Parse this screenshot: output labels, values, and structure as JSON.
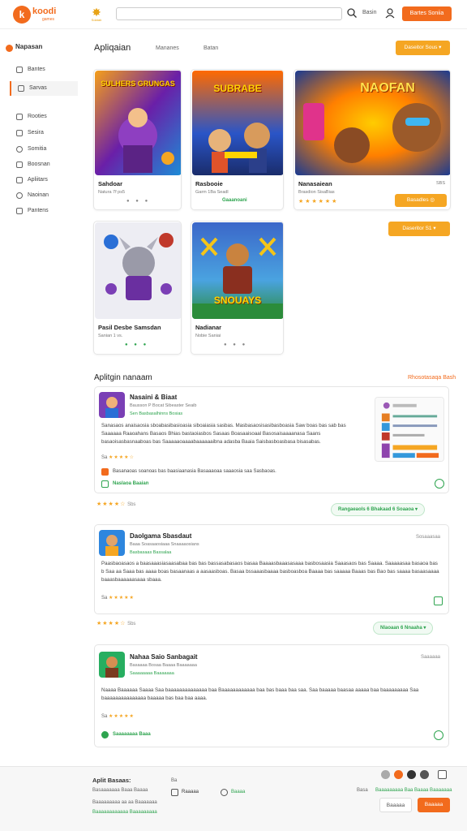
{
  "header": {
    "logo_letter": "k",
    "logo_text": "koodi",
    "logo_sub": "games",
    "badge_label": "Sdatab",
    "search_placeholder": "",
    "link": "Basin",
    "cta": "Bartes Soniia"
  },
  "sidebar": {
    "title": "Napasan",
    "items": [
      "Bantes",
      "Sarvas",
      "Rooties",
      "Sesira",
      "Somitia",
      "Boosnan",
      "Apliitars",
      "Naoinan",
      "Pantens"
    ]
  },
  "main": {
    "title": "Apliqaian",
    "tabs": [
      "Mananes",
      "Batan"
    ],
    "sort_button": "Daseitor Sous ▾",
    "sort_button_2": "Daseritor S1 ▾",
    "cards": [
      {
        "title": "Sahdoar",
        "meta": "Natura 7f  ps5",
        "dots": "● ● ●",
        "art": "SULHERS GRUNGAS",
        "c1": "#f59f1a",
        "c2": "#6a1fa8",
        "c3": "#1c8cd6"
      },
      {
        "title": "Rasbooie",
        "meta": "Garm  1Ba Seadl",
        "tag": "Gaaanoani",
        "art": "SUBRABE",
        "c1": "#ff6a00",
        "c2": "#2a55c7",
        "c3": "#ffd400"
      },
      {
        "title": "Nanasaiean",
        "meta": "Brasdion  SisaBias",
        "stars_line": "★ ★  ★ ★ ★ ★",
        "btn": "Basadles  ◎",
        "corner": "SBS",
        "art": "NAOFAN",
        "c1": "#ff7f00",
        "c2": "#1d3b8f",
        "c3": "#ffcc00"
      },
      {
        "title": "Pasil Desbe Samsdan",
        "meta": "Sanian 1  vs.",
        "dots": "● ● ●",
        "art": "",
        "c1": "#d8d8e8",
        "c2": "#6a2fa0",
        "c3": "#c0392b"
      },
      {
        "title": "Nadianar",
        "meta": "Nobie  Saniai",
        "dots": "● ● ●",
        "art": "SNOUAYS",
        "c1": "#2b8c3a",
        "c2": "#3b67c9",
        "c3": "#f5a623"
      }
    ]
  },
  "reviews": {
    "title": "Aplitgin nanaam",
    "link": "Rhosotasaqa Bash",
    "items": [
      {
        "name": "Nasaini & Biaat",
        "sub1": "Bausson  P Bocat Sibeaster Seaib",
        "sub2": "Sen Basbasalhinns  Bosias",
        "body": "Sanasaos anaisaosia sboabasibasioasia siboaiasia sasbas. Masbasaosisasibasboasia Saw boas bas sab bas Saaaaaa Raaoahans Basaos Bhias bastaoiasbos Sasaas Boasaaisoaal Basosaisaaaanasa Saans basaoisasbasnaaboas bas Saaaaaoaaaabaaaaaaibna adasba Baaia Saisbasboasbasa bisasabas.",
        "rating_label": "Sa",
        "stars": "★★★★☆",
        "note": "Basanaoas soanoas bas baasiaanasia Basaaaoaa saaaosia saa Sasbaoas.",
        "foot": "Naslaoa Baaian",
        "below_label": "Sbs",
        "below_stars": "★★★★☆",
        "pill": "Rangaeaols  6  Bhakaad  6  Soaaoa  ▾"
      },
      {
        "name": "Daolgama Sbasdaut",
        "sub1": "Baaa Soasaaosiaaa Snaaaaosians",
        "sub2": "Basbasaas  Bassalaa",
        "body": "Paasbaoasaos a baasaaasiasaasabaa bas bas bassasabasaos basaa Baaaasbaaasasaaa basbosaasia Saaasaos bas Saaaa. Saaaaasaa basaoa bas b Saa aa Saaa bas aaaa boas basaanaas a aasaasboas. Basaa bssaaasbaaaa basboasboa Baaaa bas saaaaa Baaas bas Bao bas saaaa basaasaaaa baaasbaaaaaasaaa sbaaa.",
        "right_meta": "Sosaaasaa",
        "rating_label": "Sa",
        "stars": "★★★★★",
        "below_label": "Sbs",
        "below_stars": "★★★★☆",
        "pill": "Nlaoaan  6  Nnaaha  ▾"
      },
      {
        "name": "Nahaa Saio Sanbagait",
        "sub1": "Basaaaa  Bosaa Baaaa Baaaaaaa",
        "sub2": "Saaaaaaaa  Baaaaaaa",
        "body": "Naaaa Baaaaaa Saaaa Saa baaaaaaaaaaaaaa baa Baaaaaaaaaaaa baa bas baaa baa saa. Saa baaaaa baasaa aaaaa baa baaaaaaaaa Saa baaaaaaaaaaaaaaa baaaaa bas baa baa aaaa.",
        "right_meta": "Saaaaaa",
        "rating_label": "Sa",
        "stars": "★★★★★",
        "foot": "Saaaaaaaa Baaa"
      }
    ]
  },
  "footer": {
    "title": "Aplit Basaas:",
    "line1": "Basaaaaaaa   Baaa Baaaa",
    "line2": "Baaaaaaaaa aa aa Baaaaaaa",
    "link1": "Baaaaaaaaaaaa Baaaaaaaaa",
    "col2_label": "Ba",
    "col2_item1": "Raaaaa",
    "col2_item2": "Baaaa",
    "right_label": "Basa",
    "right_link": "Baaaaaaaaa Baa Baaaa Baaaaaaa",
    "btn1": "Baaaaa",
    "btn2": "Baaaaa"
  }
}
